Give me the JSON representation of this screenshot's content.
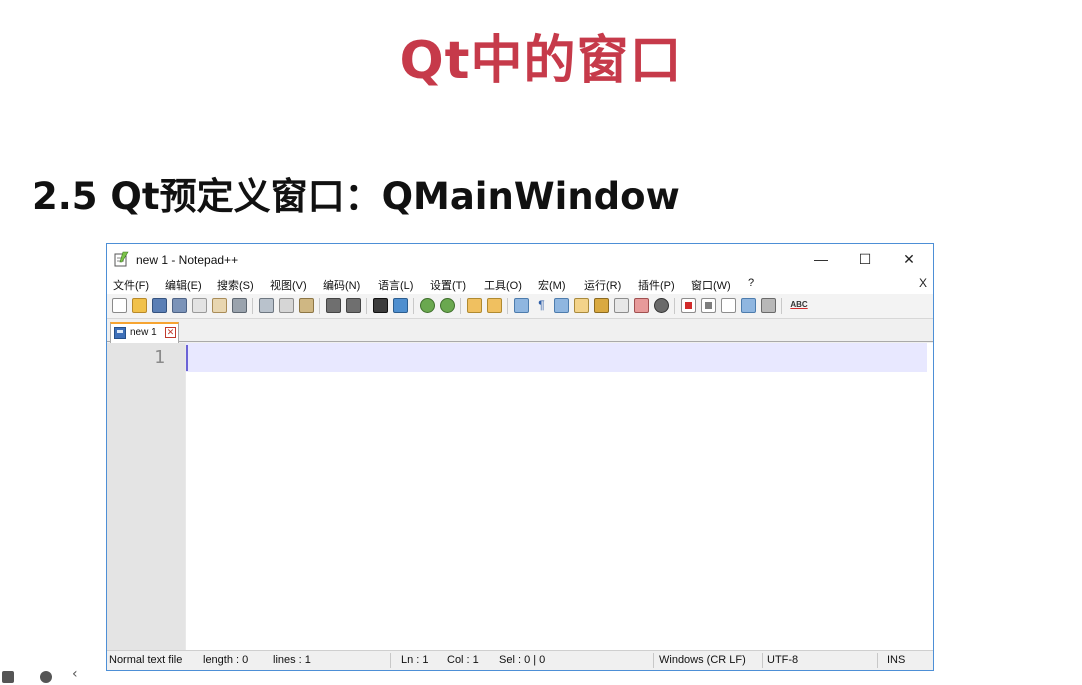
{
  "slide": {
    "title": "Qt中的窗口",
    "subtitle": "2.5 Qt预定义窗口：QMainWindow",
    "title_color": "#c63a4a"
  },
  "window": {
    "title": "new 1 - Notepad++",
    "minimize": "—",
    "maximize": "☐",
    "close": "✕",
    "app_icon": "notepad-plus-plus-icon",
    "border_color": "#4d8fd6"
  },
  "menu": {
    "items": [
      "文件(F)",
      "编辑(E)",
      "搜索(S)",
      "视图(V)",
      "编码(N)",
      "语言(L)",
      "设置(T)",
      "工具(O)",
      "宏(M)",
      "运行(R)",
      "插件(P)",
      "窗口(W)",
      "?"
    ],
    "close": "X"
  },
  "toolbar": {
    "buttons": [
      "new-file-icon",
      "open-file-icon",
      "save-icon",
      "save-all-icon",
      "close-icon",
      "close-all-icon",
      "print-icon",
      "cut-icon",
      "copy-icon",
      "paste-icon",
      "undo-icon",
      "redo-icon",
      "find-icon",
      "replace-icon",
      "zoom-in-icon",
      "zoom-out-icon",
      "sync-vertical-icon",
      "sync-horizontal-icon",
      "word-wrap-icon",
      "show-all-chars-icon",
      "indent-guide-icon",
      "udl-icon",
      "doc-map-icon",
      "function-list-icon",
      "folder-as-workspace-icon",
      "monitoring-icon",
      "record-macro-icon",
      "stop-macro-icon",
      "play-macro-icon",
      "run-macro-multiple-icon",
      "save-macro-icon",
      "spell-check-icon"
    ],
    "spell_check_label": "ABC"
  },
  "tabs": [
    {
      "label": "new 1",
      "icon": "saved-file-icon",
      "close_icon": "tab-close-icon"
    }
  ],
  "editor": {
    "line_numbers": [
      "1"
    ],
    "content": "",
    "current_line_color": "#e8e8ff"
  },
  "status": {
    "file_type": "Normal text file",
    "length": "length : 0",
    "lines": "lines : 1",
    "ln": "Ln : 1",
    "col": "Col : 1",
    "sel": "Sel : 0 | 0",
    "eol": "Windows (CR LF)",
    "encoding": "UTF-8",
    "mode": "INS"
  },
  "corner_icons": [
    "slides-icon",
    "chat-icon",
    "back-icon"
  ]
}
